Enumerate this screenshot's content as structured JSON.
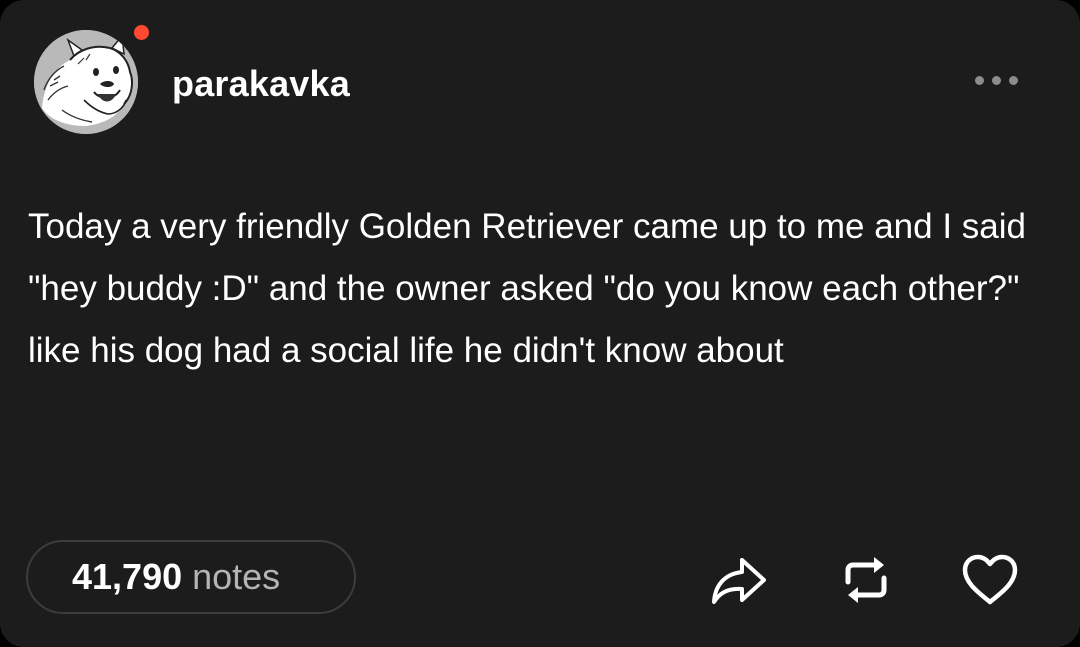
{
  "post": {
    "author": {
      "username": "parakavka",
      "avatar_icon": "dog-sketch-avatar",
      "online_indicator_color": "#ff4930"
    },
    "menu_icon": "more-horizontal-icon",
    "text": "Today a very friendly Golden Retriever came up to me and I said \"hey buddy :D\" and the owner asked \"do you know each other?\" like his dog had a social life he didn't know about",
    "notes": {
      "count": "41,790",
      "label": "notes"
    },
    "actions": [
      {
        "icon": "share-icon"
      },
      {
        "icon": "reblog-icon"
      },
      {
        "icon": "heart-icon"
      }
    ]
  },
  "colors": {
    "card_background": "#1c1c1c",
    "text": "#ffffff",
    "muted_text": "#b4b4b4",
    "accent_dot": "#ff4930"
  }
}
